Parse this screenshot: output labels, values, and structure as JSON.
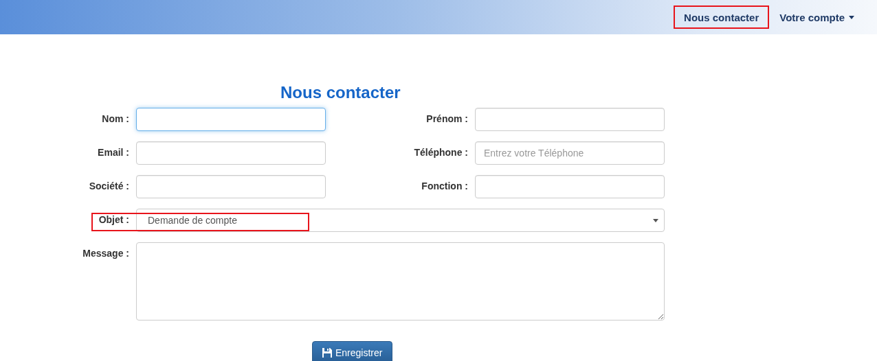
{
  "navbar": {
    "items": [
      {
        "label": "Nous contacter",
        "highlighted": true,
        "dropdown": false
      },
      {
        "label": "Votre compte",
        "highlighted": false,
        "dropdown": true
      }
    ]
  },
  "form": {
    "title": "Nous contacter",
    "fields": [
      {
        "kind": "text",
        "label": "Nom :",
        "focused": true,
        "highlighted": false
      },
      {
        "kind": "text",
        "label": "Prénom :",
        "focused": false,
        "highlighted": false
      },
      {
        "kind": "text",
        "label": "Email :",
        "focused": false,
        "highlighted": false
      },
      {
        "kind": "text",
        "label": "Téléphone :",
        "placeholder": "Entrez votre Téléphone",
        "focused": false,
        "highlighted": false
      },
      {
        "kind": "text",
        "label": "Société :",
        "focused": false,
        "highlighted": false
      },
      {
        "kind": "text",
        "label": "Fonction :",
        "focused": false,
        "highlighted": false
      },
      {
        "kind": "select",
        "label": "Objet :",
        "value": "Demande de compte",
        "focused": false,
        "highlighted": true
      },
      {
        "kind": "textarea",
        "label": "Message :",
        "focused": false,
        "highlighted": false
      }
    ],
    "submit": "Enregistrer"
  }
}
